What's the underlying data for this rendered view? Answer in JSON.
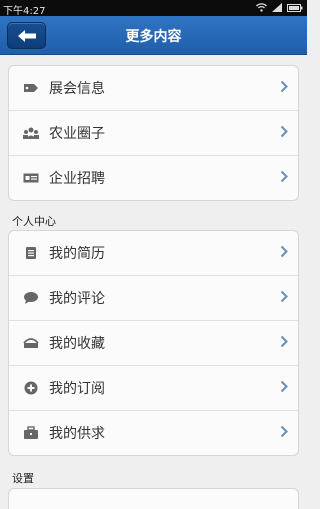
{
  "status": {
    "time": "下午4:27"
  },
  "header": {
    "title": "更多内容"
  },
  "group1": {
    "items": [
      {
        "label": "展会信息",
        "icon": "tag-icon"
      },
      {
        "label": "农业圈子",
        "icon": "group-icon"
      },
      {
        "label": "企业招聘",
        "icon": "id-card-icon"
      }
    ]
  },
  "personal": {
    "section_title": "个人中心",
    "items": [
      {
        "label": "我的简历",
        "icon": "document-icon"
      },
      {
        "label": "我的评论",
        "icon": "comment-icon"
      },
      {
        "label": "我的收藏",
        "icon": "inbox-icon"
      },
      {
        "label": "我的订阅",
        "icon": "add-circle-icon"
      },
      {
        "label": "我的供求",
        "icon": "briefcase-icon"
      }
    ]
  },
  "settings": {
    "section_title": "设置"
  }
}
